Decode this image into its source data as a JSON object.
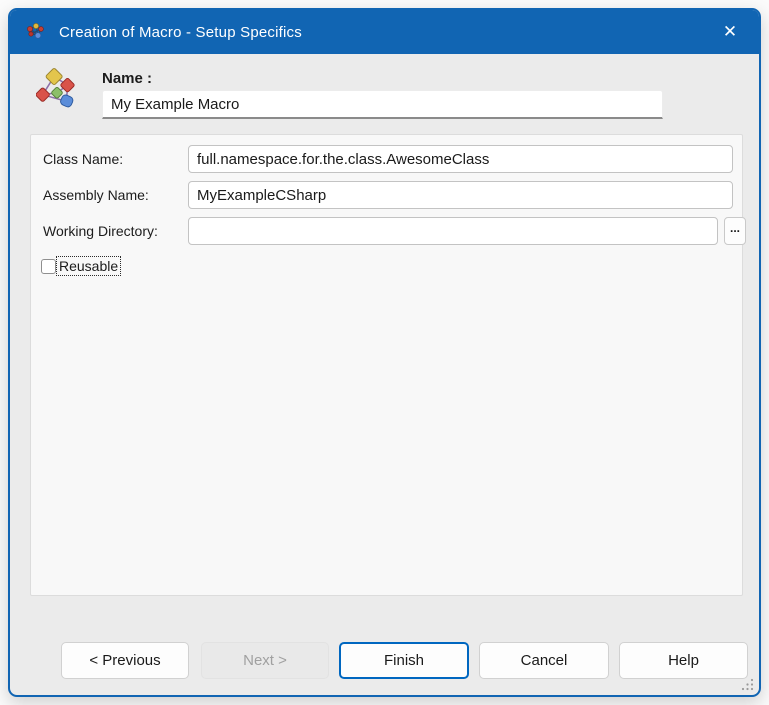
{
  "window": {
    "title": "Creation of Macro - Setup Specifics",
    "close_glyph": "✕"
  },
  "header": {
    "name_label": "Name :",
    "name_value": "My Example Macro"
  },
  "form": {
    "class_name_label": "Class Name:",
    "class_name_value": "full.namespace.for.the.class.AwesomeClass",
    "assembly_name_label": "Assembly Name:",
    "assembly_name_value": "MyExampleCSharp",
    "working_directory_label": "Working Directory:",
    "working_directory_value": "",
    "browse_label": "...",
    "reusable_label": "Reusable",
    "reusable_checked": false
  },
  "buttons": {
    "previous_label": "< Previous",
    "next_label": "Next >",
    "next_enabled": false,
    "finish_label": "Finish",
    "finish_is_default": true,
    "cancel_label": "Cancel",
    "help_label": "Help"
  },
  "icons": {
    "titlebar_icon": "molecule-network-icon",
    "header_icon": "macro-diagram-icon",
    "close_icon": "close-x-icon",
    "browse_icon": "ellipsis",
    "bottom_right": "resize-grip-dots"
  },
  "colors": {
    "titlebar_blue": "#1165b3",
    "accent_blue": "#0067c0",
    "dialog_background": "#ebebeb",
    "panel_background": "#f8f8f8",
    "disabled_text": "#a0a0a0"
  }
}
